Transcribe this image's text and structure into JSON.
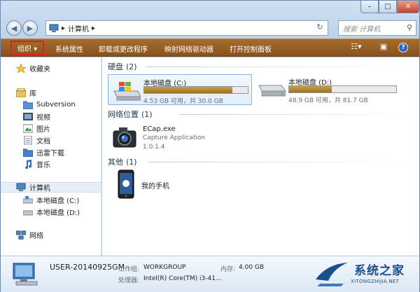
{
  "window": {
    "title": "",
    "min_glyph": "–",
    "max_glyph": "□",
    "close_glyph": "✕"
  },
  "nav": {
    "back_glyph": "◀",
    "forward_glyph": "▶",
    "address": {
      "crumb_separator": "▸",
      "location": "计算机",
      "trailing_arrow": "▸"
    },
    "refresh_glyph": "↻",
    "search_placeholder": "搜索 计算机",
    "search_glyph": "⚲"
  },
  "toolbar": {
    "organize": "组织 ▾",
    "system_properties": "系统属性",
    "uninstall_program": "卸载或更改程序",
    "map_network_drive": "映射网络驱动器",
    "open_control_panel": "打开控制面板",
    "view_glyph": "☷▾",
    "pane_glyph": "▣",
    "help_glyph": "?"
  },
  "sidebar": {
    "favorites": "收藏夹",
    "library": "库",
    "subversion": "Subversion",
    "videos": "视频",
    "pictures": "图片",
    "documents": "文档",
    "thunder": "迅雷下载",
    "music": "音乐",
    "computer": "计算机",
    "drive_c": "本地磁盘 (C:)",
    "drive_d": "本地磁盘 (D:)",
    "network": "网络"
  },
  "content": {
    "hard_disks": {
      "title": "硬盘",
      "count": "(2)"
    },
    "drives": [
      {
        "name": "本地磁盘 (C:)",
        "info": "4.53 GB 可用，共 30.0 GB",
        "used_fraction": 0.849
      },
      {
        "name": "本地磁盘 (D:)",
        "info": "48.9 GB 可用，共 81.7 GB",
        "used_fraction": 0.401
      }
    ],
    "network_locations": {
      "title": "网络位置",
      "count": "(1)"
    },
    "app": {
      "name": "ECap.exe",
      "desc": "Capture Application",
      "version": "1.0.1.4"
    },
    "other": {
      "title": "其他",
      "count": "(1)"
    },
    "phone": {
      "name": "我的手机"
    }
  },
  "details": {
    "computer_name": "USER-20140925GM",
    "workgroup_label": "工作组:",
    "workgroup": "WORKGROUP",
    "memory_label": "内存:",
    "memory": "4.00 GB",
    "cpu_label": "处理器:",
    "cpu": "Intel(R) Core(TM) i3-41..."
  },
  "watermark": {
    "brand": "系统之家",
    "url": "XITONGZHIJIA.NET"
  },
  "colors": {
    "toolbar": "#95602a",
    "selection": "#e5eef9",
    "disk_fill": "#b58a35",
    "organize_border": "#e02020"
  }
}
